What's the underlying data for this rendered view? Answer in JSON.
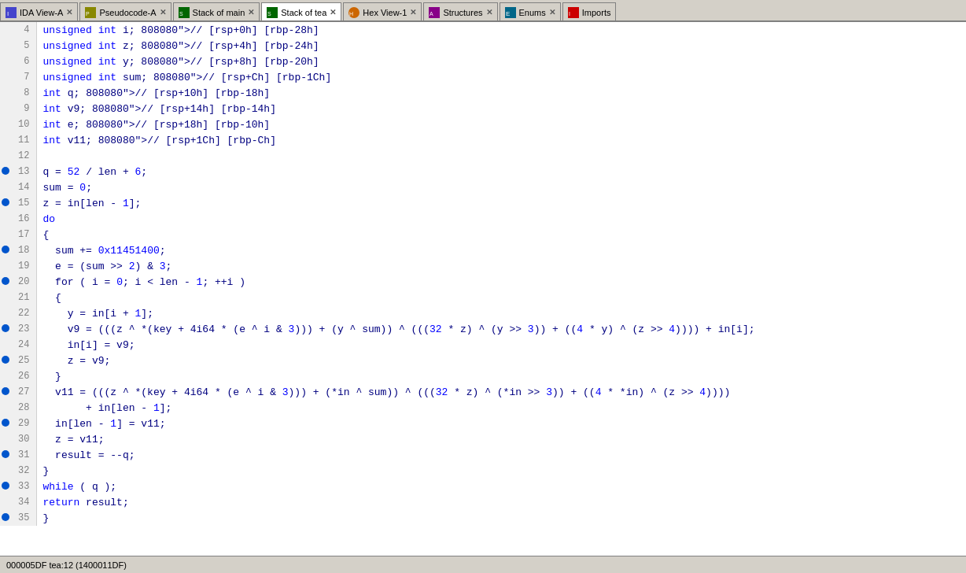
{
  "tabs": [
    {
      "id": "ida-view-a",
      "label": "IDA View-A",
      "icon": "ida",
      "active": false,
      "closable": true
    },
    {
      "id": "pseudocode-a",
      "label": "Pseudocode-A",
      "icon": "pseudo",
      "active": false,
      "closable": true
    },
    {
      "id": "stack-main",
      "label": "Stack of main",
      "icon": "stack",
      "active": false,
      "closable": true
    },
    {
      "id": "stack-tea",
      "label": "Stack of tea",
      "icon": "stack",
      "active": true,
      "closable": true
    },
    {
      "id": "hex-view-1",
      "label": "Hex View-1",
      "icon": "hex",
      "active": false,
      "closable": true
    },
    {
      "id": "structures",
      "label": "Structures",
      "icon": "struct",
      "active": false,
      "closable": true
    },
    {
      "id": "enums",
      "label": "Enums",
      "icon": "enum",
      "active": false,
      "closable": true
    },
    {
      "id": "imports",
      "label": "Imports",
      "icon": "imports",
      "active": false,
      "closable": false
    }
  ],
  "status_bar": "000005DF tea:12 (1400011DF)",
  "code_lines": [
    {
      "num": 4,
      "bp": false,
      "code": "unsigned int i; // [rsp+0h] [rbp-28h]",
      "highlight": false
    },
    {
      "num": 5,
      "bp": false,
      "code": "unsigned int z; // [rsp+4h] [rbp-24h]",
      "highlight": false
    },
    {
      "num": 6,
      "bp": false,
      "code": "unsigned int y; // [rsp+8h] [rbp-20h]",
      "highlight": false
    },
    {
      "num": 7,
      "bp": false,
      "code": "unsigned int sum; // [rsp+Ch] [rbp-1Ch]",
      "highlight": false
    },
    {
      "num": 8,
      "bp": false,
      "code": "int q; // [rsp+10h] [rbp-18h]",
      "highlight": false
    },
    {
      "num": 9,
      "bp": false,
      "code": "int v9; // [rsp+14h] [rbp-14h]",
      "highlight": false
    },
    {
      "num": 10,
      "bp": false,
      "code": "int e; // [rsp+18h] [rbp-10h]",
      "highlight": false
    },
    {
      "num": 11,
      "bp": false,
      "code": "int v11; // [rsp+1Ch] [rbp-Ch]",
      "highlight": false
    },
    {
      "num": 12,
      "bp": false,
      "code": "",
      "highlight": false
    },
    {
      "num": 13,
      "bp": true,
      "code": "q = 52 / len + 6;",
      "highlight": false
    },
    {
      "num": 14,
      "bp": false,
      "code": "sum = 0;",
      "highlight": false
    },
    {
      "num": 15,
      "bp": true,
      "code": "z = in[len - 1];",
      "highlight": false
    },
    {
      "num": 16,
      "bp": false,
      "code": "do",
      "highlight": false
    },
    {
      "num": 17,
      "bp": false,
      "code": "{",
      "highlight": false
    },
    {
      "num": 18,
      "bp": true,
      "code": "  sum += 0x11451400;",
      "highlight": false
    },
    {
      "num": 19,
      "bp": false,
      "code": "  e = (sum >> 2) & 3;",
      "highlight": false
    },
    {
      "num": 20,
      "bp": true,
      "code": "  for ( i = 0; i < len - 1; ++i )",
      "highlight": false
    },
    {
      "num": 21,
      "bp": false,
      "code": "  {",
      "highlight": false
    },
    {
      "num": 22,
      "bp": false,
      "code": "    y = in[i + 1];",
      "highlight": false
    },
    {
      "num": 23,
      "bp": true,
      "code": "    v9 = (((z ^ *(key + 4i64 * (e ^ i & 3))) + (y ^ sum)) ^ (((32 * z) ^ (y >> 3)) + ((4 * y) ^ (z >> 4)))) + in[i];",
      "highlight": false
    },
    {
      "num": 24,
      "bp": false,
      "code": "    in[i] = v9;",
      "highlight": false
    },
    {
      "num": 25,
      "bp": true,
      "code": "    z = v9;",
      "highlight": false
    },
    {
      "num": 26,
      "bp": false,
      "code": "  }",
      "highlight": false
    },
    {
      "num": 27,
      "bp": true,
      "code": "  v11 = (((z ^ *(key + 4i64 * (e ^ i & 3))) + (*in ^ sum)) ^ (((32 * z) ^ (*in >> 3)) + ((4 * *in) ^ (z >> 4))))",
      "highlight": false
    },
    {
      "num": 28,
      "bp": false,
      "code": "       + in[len - 1];",
      "highlight": false
    },
    {
      "num": 29,
      "bp": true,
      "code": "  in[len - 1] = v11;",
      "highlight": false
    },
    {
      "num": 30,
      "bp": false,
      "code": "  z = v11;",
      "highlight": false
    },
    {
      "num": 31,
      "bp": true,
      "code": "  result = --q;",
      "highlight": false
    },
    {
      "num": 32,
      "bp": false,
      "code": "}",
      "highlight": false
    },
    {
      "num": 33,
      "bp": true,
      "code": "while ( q );",
      "highlight": false
    },
    {
      "num": 34,
      "bp": false,
      "code": "return result;",
      "highlight": false
    },
    {
      "num": 35,
      "bp": true,
      "code": "}",
      "highlight": false
    }
  ]
}
